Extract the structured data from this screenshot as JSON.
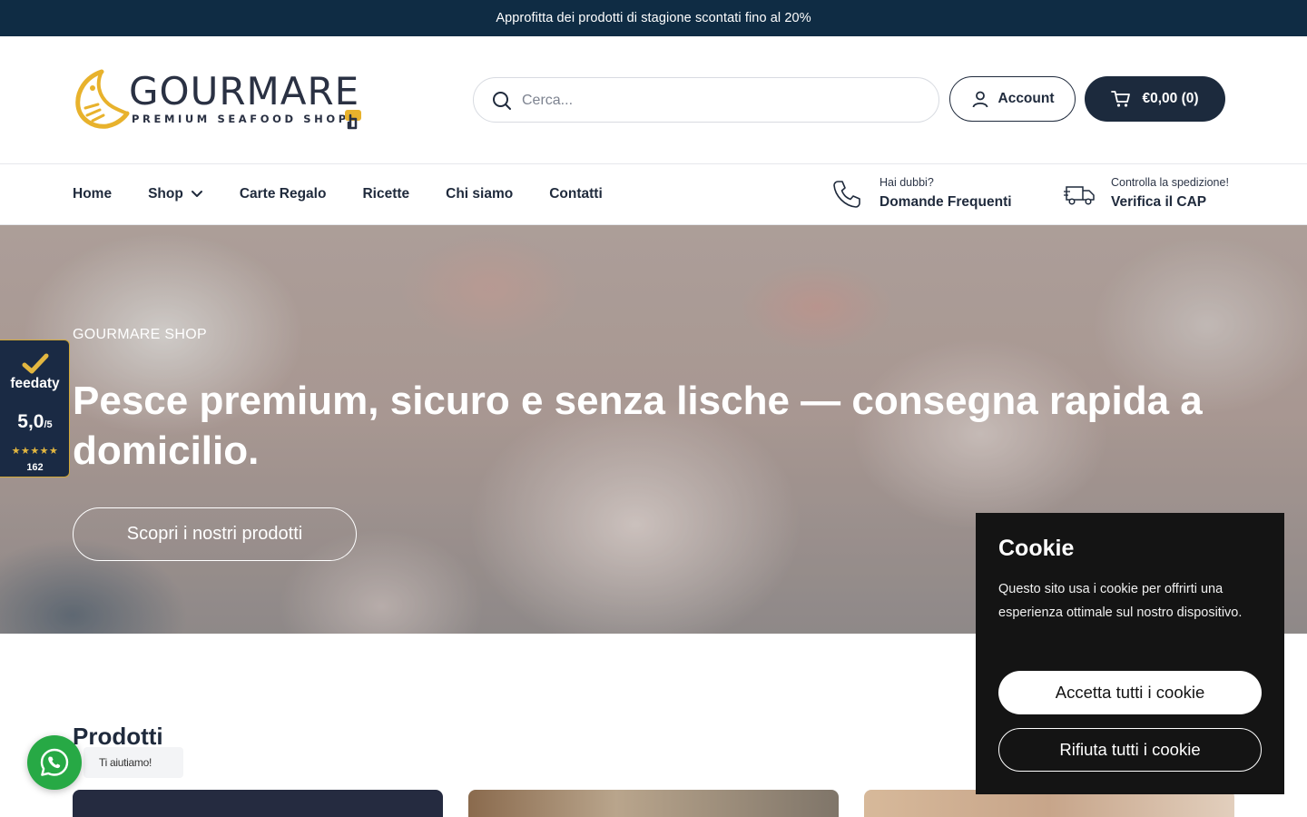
{
  "announcement": {
    "text": "Approfitta dei prodotti di stagione scontati fino al 20%"
  },
  "logo": {
    "name": "GOURMARE",
    "tagline": "PREMIUM SEAFOOD SHOP"
  },
  "search": {
    "placeholder": "Cerca..."
  },
  "account": {
    "label": "Account"
  },
  "cart": {
    "label": "€0,00 (0)"
  },
  "nav": {
    "items": [
      {
        "label": "Home"
      },
      {
        "label": "Shop",
        "has_dropdown": true
      },
      {
        "label": "Carte Regalo"
      },
      {
        "label": "Ricette"
      },
      {
        "label": "Chi siamo"
      },
      {
        "label": "Contatti"
      }
    ],
    "faq": {
      "small": "Hai dubbi?",
      "big": "Domande Frequenti",
      "icon": "phone-icon"
    },
    "shipping": {
      "small": "Controlla la spedizione!",
      "big": "Verifica il CAP",
      "icon": "truck-icon"
    }
  },
  "hero": {
    "eyebrow": "GOURMARE SHOP",
    "title": "Pesce premium, sicuro e senza lische — consegna rapida a domicilio.",
    "cta": "Scopri i nostri prodotti"
  },
  "feedaty": {
    "brand": "feedaty",
    "score": "5,0",
    "scale": "/5",
    "stars": "★★★★★",
    "count": "162"
  },
  "products": {
    "title": "Prodotti"
  },
  "whatsapp": {
    "tooltip": "Ti aiutiamo!"
  },
  "cookie": {
    "title": "Cookie",
    "text": "Questo sito usa i cookie per offrirti una esperienza ottimale sul nostro dispositivo.",
    "accept": "Accetta tutti i cookie",
    "reject": "Rifiuta tutti i cookie"
  },
  "colors": {
    "announcement_bg": "#0f2c44",
    "primary": "#1c2a3d",
    "logo_accent": "#e8b22c",
    "whatsapp": "#27a945"
  }
}
